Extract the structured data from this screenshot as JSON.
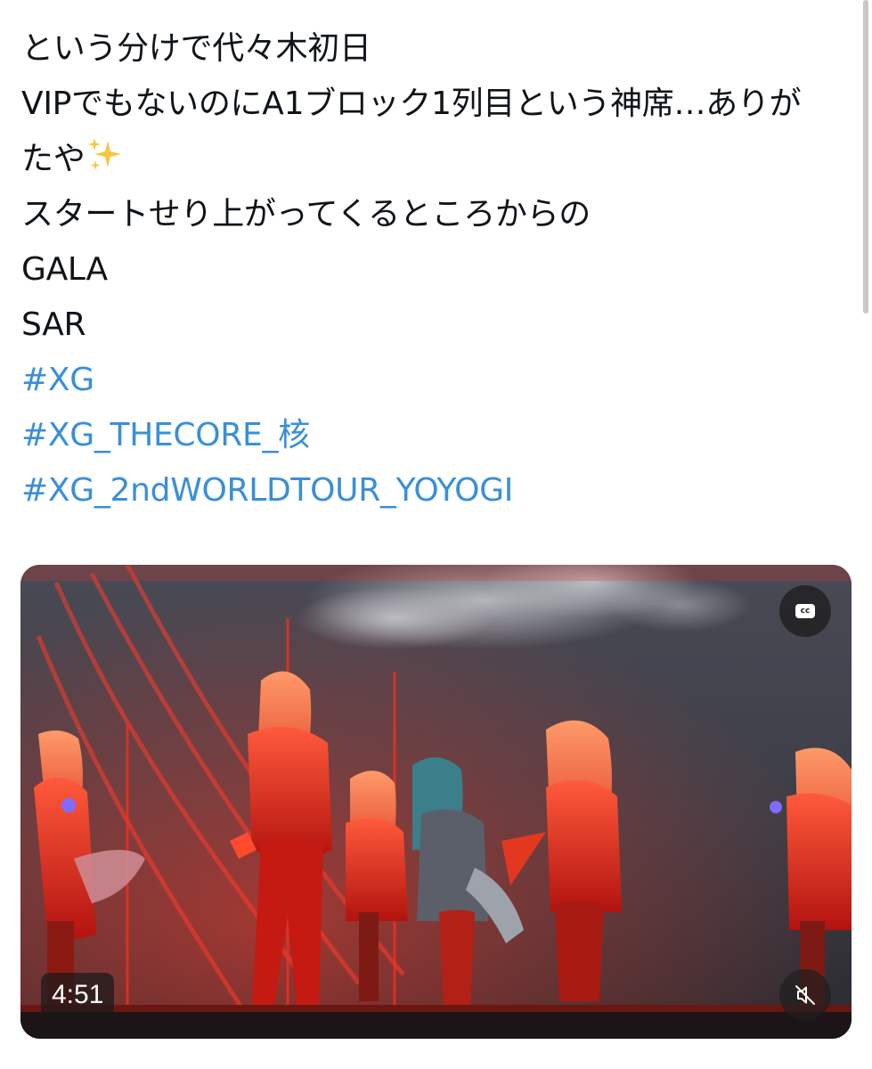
{
  "post": {
    "lines": [
      "という分けで代々木初日",
      "VIPでもないのにA1ブロック1列目という神席…ありが",
      "たや",
      "スタートせり上がってくるところからの",
      "GALA",
      "SAR"
    ],
    "sparkle_emoji": "✨",
    "hashtags": [
      "#XG",
      "#XG_THECORE_核",
      "#XG_2ndWORLDTOUR_YOYOGI"
    ]
  },
  "video": {
    "duration": "4:51",
    "cc_label": "cc",
    "captions_icon": "closed-captions-icon",
    "mute_icon": "speaker-muted-icon"
  },
  "colors": {
    "text": "#0f1419",
    "hashtag": "#3a8fd8",
    "background": "#ffffff"
  }
}
